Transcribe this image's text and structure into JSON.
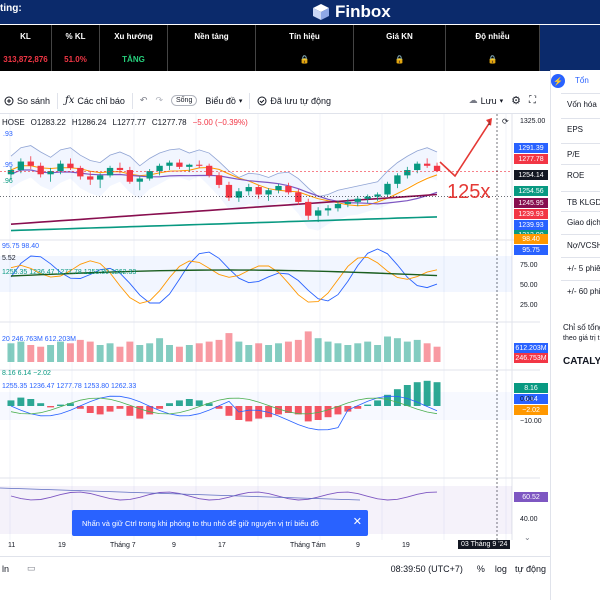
{
  "banner": {
    "left_text": "ting:",
    "brand": "Finbox"
  },
  "table": {
    "headers": [
      "KL",
      "% KL",
      "Xu hướng",
      "Nền tảng",
      "Tín hiệu",
      "Giá KN",
      "Độ nhiễu"
    ],
    "row": [
      "313,872,876",
      "51.0%",
      "TĂNG",
      "",
      "",
      "",
      ""
    ],
    "lock_icon": "lock-icon"
  },
  "toolbar": {
    "compare": "So sánh",
    "indicators": "Các chỉ báo",
    "live": "Sống",
    "chart_type": "Biểu đồ",
    "autosave": "Đã lưu tự động",
    "save": "Lưu"
  },
  "ohlc": {
    "symbol": "HOSE",
    "o": "O1283.22",
    "h": "H1286.24",
    "l": "L1277.77",
    "c": "C1277.78",
    "chg": "−5.00 (−0.39%)"
  },
  "chart_data": {
    "type": "candlestick",
    "candles": [
      {
        "o": 1275,
        "h": 1282,
        "l": 1270,
        "c": 1279
      },
      {
        "o": 1279,
        "h": 1290,
        "l": 1276,
        "c": 1287
      },
      {
        "o": 1287,
        "h": 1292,
        "l": 1280,
        "c": 1283
      },
      {
        "o": 1283,
        "h": 1286,
        "l": 1272,
        "c": 1275
      },
      {
        "o": 1275,
        "h": 1281,
        "l": 1268,
        "c": 1278
      },
      {
        "o": 1278,
        "h": 1288,
        "l": 1275,
        "c": 1285
      },
      {
        "o": 1285,
        "h": 1290,
        "l": 1279,
        "c": 1281
      },
      {
        "o": 1281,
        "h": 1283,
        "l": 1270,
        "c": 1273
      },
      {
        "o": 1273,
        "h": 1278,
        "l": 1265,
        "c": 1270
      },
      {
        "o": 1270,
        "h": 1276,
        "l": 1262,
        "c": 1274
      },
      {
        "o": 1274,
        "h": 1283,
        "l": 1272,
        "c": 1281
      },
      {
        "o": 1281,
        "h": 1286,
        "l": 1276,
        "c": 1279
      },
      {
        "o": 1279,
        "h": 1282,
        "l": 1266,
        "c": 1268
      },
      {
        "o": 1268,
        "h": 1273,
        "l": 1260,
        "c": 1271
      },
      {
        "o": 1271,
        "h": 1280,
        "l": 1269,
        "c": 1278
      },
      {
        "o": 1278,
        "h": 1285,
        "l": 1274,
        "c": 1283
      },
      {
        "o": 1283,
        "h": 1288,
        "l": 1279,
        "c": 1286
      },
      {
        "o": 1286,
        "h": 1289,
        "l": 1280,
        "c": 1282
      },
      {
        "o": 1282,
        "h": 1285,
        "l": 1277,
        "c": 1284
      },
      {
        "o": 1284,
        "h": 1288,
        "l": 1281,
        "c": 1283
      },
      {
        "o": 1283,
        "h": 1285,
        "l": 1272,
        "c": 1274
      },
      {
        "o": 1274,
        "h": 1277,
        "l": 1262,
        "c": 1265
      },
      {
        "o": 1265,
        "h": 1268,
        "l": 1250,
        "c": 1253
      },
      {
        "o": 1253,
        "h": 1262,
        "l": 1249,
        "c": 1259
      },
      {
        "o": 1259,
        "h": 1266,
        "l": 1255,
        "c": 1263
      },
      {
        "o": 1263,
        "h": 1265,
        "l": 1252,
        "c": 1256
      },
      {
        "o": 1256,
        "h": 1262,
        "l": 1250,
        "c": 1260
      },
      {
        "o": 1260,
        "h": 1266,
        "l": 1257,
        "c": 1264
      },
      {
        "o": 1264,
        "h": 1267,
        "l": 1256,
        "c": 1258
      },
      {
        "o": 1258,
        "h": 1261,
        "l": 1246,
        "c": 1249
      },
      {
        "o": 1249,
        "h": 1252,
        "l": 1232,
        "c": 1236
      },
      {
        "o": 1236,
        "h": 1244,
        "l": 1230,
        "c": 1241
      },
      {
        "o": 1241,
        "h": 1246,
        "l": 1236,
        "c": 1243
      },
      {
        "o": 1243,
        "h": 1250,
        "l": 1240,
        "c": 1247
      },
      {
        "o": 1247,
        "h": 1252,
        "l": 1244,
        "c": 1249
      },
      {
        "o": 1249,
        "h": 1254,
        "l": 1245,
        "c": 1252
      },
      {
        "o": 1252,
        "h": 1256,
        "l": 1248,
        "c": 1254
      },
      {
        "o": 1254,
        "h": 1258,
        "l": 1250,
        "c": 1256
      },
      {
        "o": 1256,
        "h": 1268,
        "l": 1254,
        "c": 1266
      },
      {
        "o": 1266,
        "h": 1276,
        "l": 1262,
        "c": 1274
      },
      {
        "o": 1274,
        "h": 1282,
        "l": 1271,
        "c": 1279
      },
      {
        "o": 1279,
        "h": 1287,
        "l": 1276,
        "c": 1285
      },
      {
        "o": 1285,
        "h": 1290,
        "l": 1281,
        "c": 1283
      },
      {
        "o": 1283,
        "h": 1286,
        "l": 1277,
        "c": 1278
      }
    ],
    "price_range": [
      1215,
      1328
    ],
    "volumes": [
      0.55,
      0.6,
      0.5,
      0.45,
      0.5,
      0.6,
      0.55,
      0.65,
      0.6,
      0.5,
      0.55,
      0.45,
      0.6,
      0.5,
      0.55,
      0.7,
      0.5,
      0.45,
      0.5,
      0.55,
      0.6,
      0.65,
      0.85,
      0.6,
      0.5,
      0.55,
      0.5,
      0.55,
      0.6,
      0.65,
      0.9,
      0.7,
      0.6,
      0.55,
      0.5,
      0.55,
      0.6,
      0.5,
      0.75,
      0.7,
      0.6,
      0.65,
      0.55,
      0.45
    ],
    "macd_hist": [
      0.2,
      0.3,
      0.25,
      0.1,
      -0.05,
      0.05,
      0.1,
      -0.1,
      -0.25,
      -0.3,
      -0.2,
      -0.1,
      -0.35,
      -0.45,
      -0.3,
      -0.1,
      0.1,
      0.2,
      0.25,
      0.2,
      0.1,
      -0.1,
      -0.35,
      -0.5,
      -0.55,
      -0.45,
      -0.4,
      -0.3,
      -0.25,
      -0.3,
      -0.55,
      -0.5,
      -0.4,
      -0.3,
      -0.2,
      -0.1,
      0.05,
      0.2,
      0.4,
      0.6,
      0.75,
      0.85,
      0.9,
      0.85
    ]
  },
  "price_tags": [
    {
      "label": "1291.39",
      "color": "#2962ff"
    },
    {
      "label": "1277.78",
      "color": "#f23645"
    },
    {
      "label": "1254.14",
      "color": "#131722"
    },
    {
      "label": "1254.56",
      "color": "#089981"
    },
    {
      "label": "1245.95",
      "color": "#880e4f"
    },
    {
      "label": "1239.93",
      "color": "#f23645"
    },
    {
      "label": "1239.93",
      "color": "#2962ff"
    },
    {
      "label": "1213.90",
      "color": "#089981"
    }
  ],
  "price_axis": {
    "top": "1325.00"
  },
  "annotation": "125x",
  "rsi": {
    "values": "95.75  98.40",
    "tags": [
      {
        "label": "98.40",
        "color": "#ff9800"
      },
      {
        "label": "95.75",
        "color": "#2962ff"
      }
    ],
    "axis": [
      "75.00",
      "50.00",
      "25.00"
    ],
    "sub": "1255.35  1236.47  1277.78  1253.80  1262.33",
    "left_frag": "5.52"
  },
  "volume_pane": {
    "values": "20  246.763M  612.203M",
    "tags": [
      {
        "label": "612.203M",
        "color": "#2962ff"
      },
      {
        "label": "246.753M",
        "color": "#f23645"
      }
    ]
  },
  "macd_pane": {
    "values": "8.16  6.14  −2.02",
    "sub": "1255.35  1236.47  1277.78  1253.80  1262.33",
    "tags": [
      {
        "label": "8.16",
        "color": "#089981"
      },
      {
        "label": "6.14",
        "color": "#2962ff"
      },
      {
        "label": "−2.02",
        "color": "#ff9800"
      }
    ],
    "axis": [
      "0.00",
      "−10.00"
    ]
  },
  "osc_pane": {
    "tags": [
      {
        "label": "60.52",
        "color": "#7e57c2"
      }
    ],
    "axis": [
      "40.00"
    ]
  },
  "x_axis": [
    "11",
    "19",
    "Tháng 7",
    "9",
    "17",
    "Tháng Tám",
    "9",
    "19"
  ],
  "x_cursor": "03 Tháng 9 '24",
  "left_frags": [
    ".93",
    ".95",
    ".96"
  ],
  "toast": "Nhấn và giữ Ctrl trong khi phóng to thu nhỏ để giữ nguyên vị trí biểu đồ",
  "bottom": {
    "time": "08:39:50 (UTC+7)",
    "pct": "%",
    "log": "log",
    "auto": "tự động",
    "left": "ln"
  },
  "right_panel": {
    "tab": "Tổn",
    "rows": [
      "Vốn hóa",
      "EPS",
      "P/E",
      "ROE",
      "TB KLGD",
      "Giao dịch",
      "Nợ/VCSH",
      "+/- 5 phiên",
      "+/- 60 phiê"
    ],
    "note1": "Chỉ số tổng",
    "note2": "theo giá trị t",
    "catalyst": "CATALYS"
  }
}
